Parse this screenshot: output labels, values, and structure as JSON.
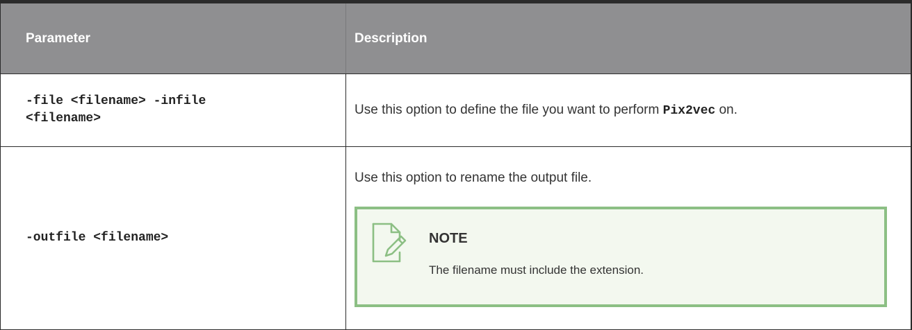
{
  "table": {
    "headers": {
      "parameter": "Parameter",
      "description": "Description"
    },
    "rows": [
      {
        "parameter_line1": "-file <filename> -infile",
        "parameter_line2": "<filename>",
        "description_before": "Use this option to define the file you want to perform ",
        "description_code": "Pix2vec",
        "description_after": " on."
      },
      {
        "parameter": "-outfile <filename>",
        "description": "Use this option to rename the output file.",
        "note": {
          "icon": "note-edit-icon",
          "title": "NOTE",
          "body": "The filename must include the extension."
        }
      }
    ]
  },
  "colors": {
    "header_bg": "#8f8f91",
    "note_border": "#8cbf84",
    "note_bg": "#f3f8ef"
  }
}
